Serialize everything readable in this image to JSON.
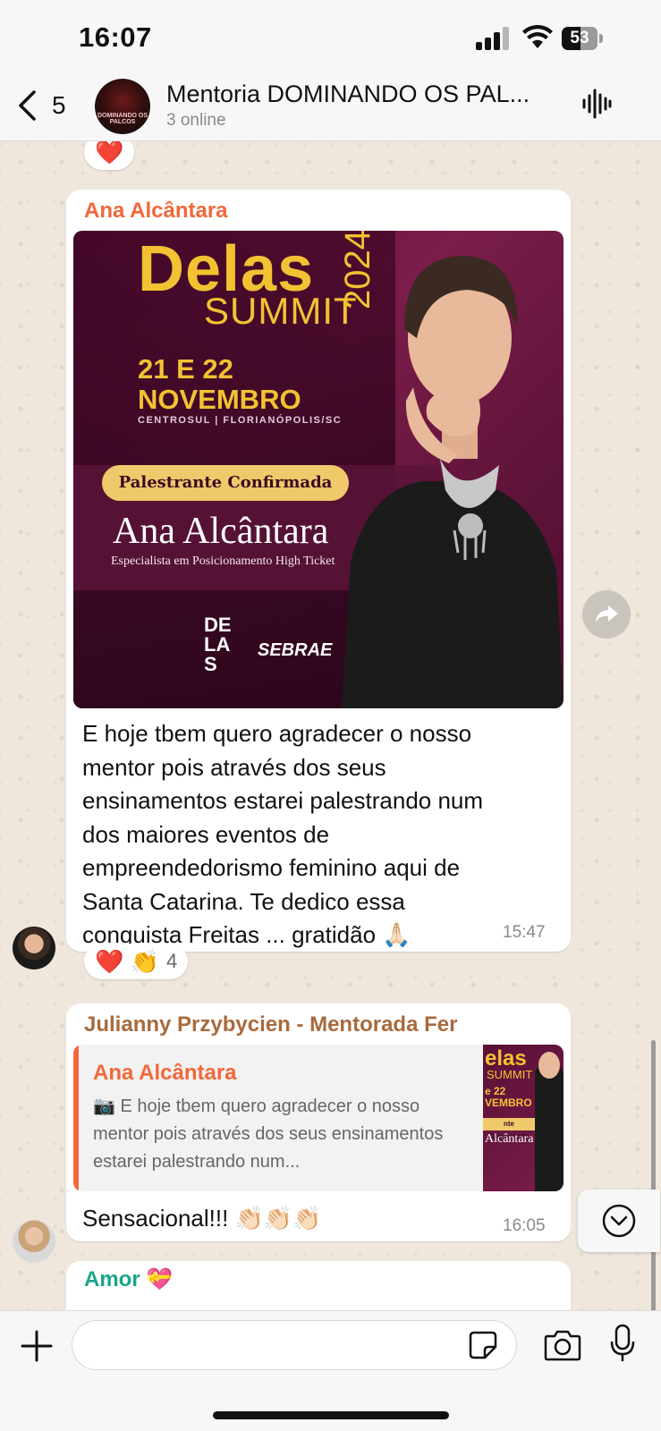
{
  "status_bar": {
    "time": "16:07",
    "battery": "53",
    "battery_level_percent": 53
  },
  "header": {
    "back_count": "5",
    "group_name": "Mentoria DOMINANDO OS PAL...",
    "subtitle": "3 online",
    "avatar_caption": "DOMINANDO OS PALCOS"
  },
  "messages": [
    {
      "sender": "Ana Alcântara",
      "sender_color": "#f2673a",
      "image": {
        "title": "Delas",
        "subtitle": "SUMMIT",
        "year": "2024",
        "dates_line1": "21 E 22",
        "dates_line2": "NOVEMBRO",
        "venue": "CENTROSUL | FLORIANÓPOLIS/SC",
        "badge": "Palestrante Confirmada",
        "speaker": "Ana Alcântara",
        "role": "Especialista em Posicionamento High Ticket",
        "logo_delas": "DE LA S",
        "logo_sebrae": "SEBRAE"
      },
      "text_lines": [
        "E hoje tbem quero agradecer o nosso",
        "mentor pois através dos seus",
        "ensinamentos estarei palestrando num",
        "dos maiores eventos de",
        "empreendedorismo feminino aqui de",
        "Santa Catarina. Te dedico essa",
        "conquista Freitas ... gratidão 🙏🏻"
      ],
      "time": "15:47",
      "reactions": "❤️ 👏",
      "reaction_count": "4"
    },
    {
      "sender": "Julianny Przybycien - Mentorada Fer",
      "sender_color": "#a86a3c",
      "quote": {
        "sender": "Ana Alcântara",
        "text": "📷 E hoje tbem quero agradecer o nosso mentor pois através dos seus ensinamentos estarei palestrando num...",
        "thumb_title": "elas",
        "thumb_sub": "SUMMIT",
        "thumb_dates": "e 22 VEMBRO",
        "thumb_badge": "nte Confirmada",
        "thumb_name": "Alcântara"
      },
      "text": "Sensacional!!! 👏🏻👏🏻👏🏻",
      "time": "16:05"
    },
    {
      "sender": "Amor 💝",
      "sender_color": "#1aa58a"
    }
  ],
  "top_reaction": "❤️",
  "input": {
    "placeholder": ""
  },
  "colors": {
    "chat_bg": "#efe7dc",
    "bubble": "#ffffff",
    "accent_gold": "#f2c232",
    "poster_bg": "#5a1038"
  }
}
